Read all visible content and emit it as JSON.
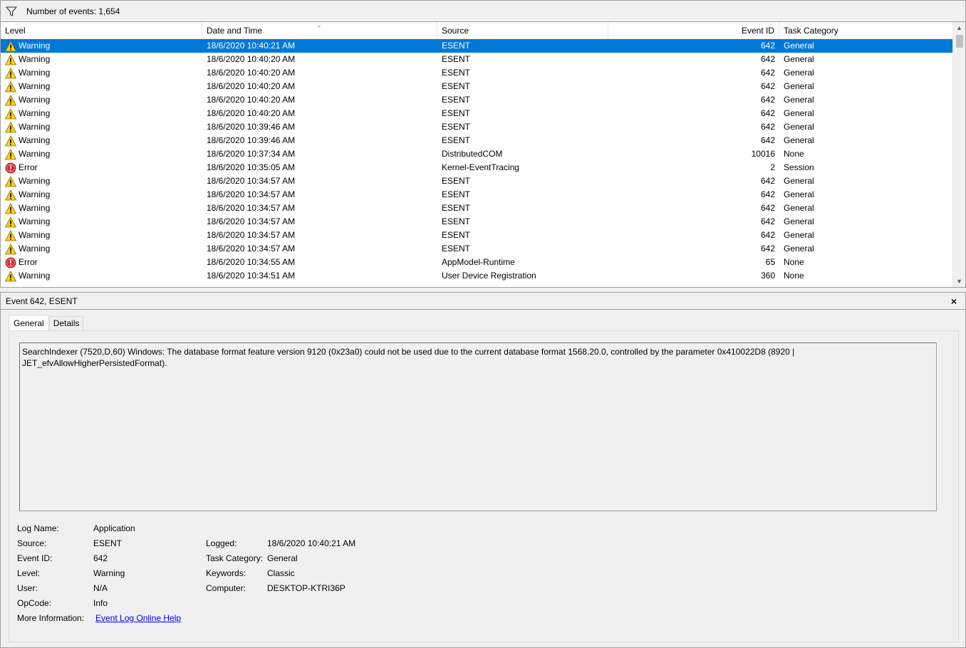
{
  "filter_bar": {
    "count_text": "Number of events: 1,654",
    "icon": "filter-icon"
  },
  "columns": {
    "level": "Level",
    "date": "Date and Time",
    "source": "Source",
    "event_id": "Event ID",
    "task_category": "Task Category"
  },
  "events": [
    {
      "level": "Warning",
      "date": "18/6/2020 10:40:21 AM",
      "source": "ESENT",
      "event_id": "642",
      "category": "General",
      "selected": true
    },
    {
      "level": "Warning",
      "date": "18/6/2020 10:40:20 AM",
      "source": "ESENT",
      "event_id": "642",
      "category": "General"
    },
    {
      "level": "Warning",
      "date": "18/6/2020 10:40:20 AM",
      "source": "ESENT",
      "event_id": "642",
      "category": "General"
    },
    {
      "level": "Warning",
      "date": "18/6/2020 10:40:20 AM",
      "source": "ESENT",
      "event_id": "642",
      "category": "General"
    },
    {
      "level": "Warning",
      "date": "18/6/2020 10:40:20 AM",
      "source": "ESENT",
      "event_id": "642",
      "category": "General"
    },
    {
      "level": "Warning",
      "date": "18/6/2020 10:40:20 AM",
      "source": "ESENT",
      "event_id": "642",
      "category": "General"
    },
    {
      "level": "Warning",
      "date": "18/6/2020 10:39:46 AM",
      "source": "ESENT",
      "event_id": "642",
      "category": "General"
    },
    {
      "level": "Warning",
      "date": "18/6/2020 10:39:46 AM",
      "source": "ESENT",
      "event_id": "642",
      "category": "General"
    },
    {
      "level": "Warning",
      "date": "18/6/2020 10:37:34 AM",
      "source": "DistributedCOM",
      "event_id": "10016",
      "category": "None"
    },
    {
      "level": "Error",
      "date": "18/6/2020 10:35:05 AM",
      "source": "Kernel-EventTracing",
      "event_id": "2",
      "category": "Session"
    },
    {
      "level": "Warning",
      "date": "18/6/2020 10:34:57 AM",
      "source": "ESENT",
      "event_id": "642",
      "category": "General"
    },
    {
      "level": "Warning",
      "date": "18/6/2020 10:34:57 AM",
      "source": "ESENT",
      "event_id": "642",
      "category": "General"
    },
    {
      "level": "Warning",
      "date": "18/6/2020 10:34:57 AM",
      "source": "ESENT",
      "event_id": "642",
      "category": "General"
    },
    {
      "level": "Warning",
      "date": "18/6/2020 10:34:57 AM",
      "source": "ESENT",
      "event_id": "642",
      "category": "General"
    },
    {
      "level": "Warning",
      "date": "18/6/2020 10:34:57 AM",
      "source": "ESENT",
      "event_id": "642",
      "category": "General"
    },
    {
      "level": "Warning",
      "date": "18/6/2020 10:34:57 AM",
      "source": "ESENT",
      "event_id": "642",
      "category": "General"
    },
    {
      "level": "Error",
      "date": "18/6/2020 10:34:55 AM",
      "source": "AppModel-Runtime",
      "event_id": "65",
      "category": "None"
    },
    {
      "level": "Warning",
      "date": "18/6/2020 10:34:51 AM",
      "source": "User Device Registration",
      "event_id": "360",
      "category": "None"
    }
  ],
  "detail": {
    "title": "Event 642, ESENT",
    "close_icon": "×",
    "tabs": [
      "General",
      "Details"
    ],
    "message": "SearchIndexer (7520,D,60) Windows: The database format feature version 9120 (0x23a0) could not be used due to the current database format 1568.20.0, controlled by the parameter 0x410022D8 (8920 | JET_efvAllowHigherPersistedFormat).",
    "props": {
      "log_name_label": "Log Name:",
      "log_name": "Application",
      "source_label": "Source:",
      "source": "ESENT",
      "logged_label": "Logged:",
      "logged": "18/6/2020 10:40:21 AM",
      "event_id_label": "Event ID:",
      "event_id": "642",
      "task_category_label": "Task Category:",
      "task_category": "General",
      "level_label": "Level:",
      "level": "Warning",
      "keywords_label": "Keywords:",
      "keywords": "Classic",
      "user_label": "User:",
      "user": "N/A",
      "computer_label": "Computer:",
      "computer": "DESKTOP-KTRI36P",
      "opcode_label": "OpCode:",
      "opcode": "Info",
      "more_info_label": "More Information:",
      "more_info_link": "Event Log Online Help"
    }
  }
}
